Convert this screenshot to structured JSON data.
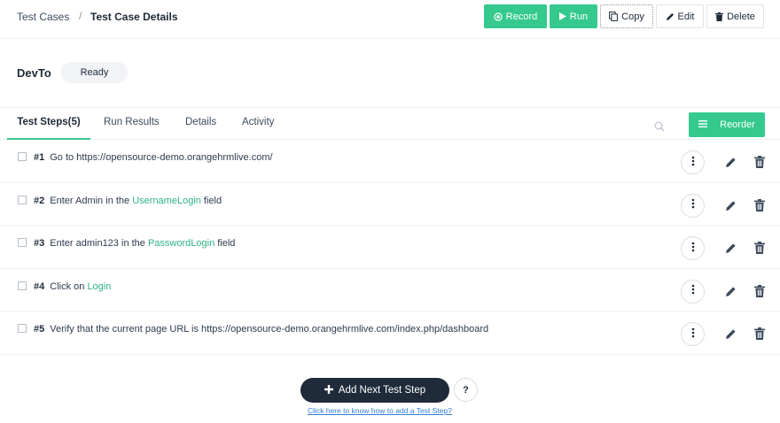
{
  "breadcrumb": {
    "parent": "Test Cases",
    "separator": "/",
    "current": "Test Case Details"
  },
  "toolbar": {
    "record_label": "Record",
    "run_label": "Run",
    "copy_label": "Copy",
    "edit_label": "Edit",
    "delete_label": "Delete"
  },
  "test_case": {
    "title": "DevTo",
    "status": "Ready"
  },
  "tabs": [
    {
      "label": "Test Steps(5)",
      "active": true
    },
    {
      "label": "Run Results",
      "active": false
    },
    {
      "label": "Details",
      "active": false
    },
    {
      "label": "Activity",
      "active": false
    }
  ],
  "reorder_label": "Reorder",
  "steps": [
    {
      "num": "#1",
      "parts": [
        {
          "text": "Go to ",
          "hl": false
        },
        {
          "text": "https://opensource-demo.orangehrmlive.com/",
          "hl": false
        }
      ]
    },
    {
      "num": "#2",
      "parts": [
        {
          "text": "Enter ",
          "hl": false
        },
        {
          "text": "Admin",
          "hl": false
        },
        {
          "text": " in the ",
          "hl": false
        },
        {
          "text": "UsernameLogin",
          "hl": true
        },
        {
          "text": " field",
          "hl": false
        }
      ]
    },
    {
      "num": "#3",
      "parts": [
        {
          "text": "Enter ",
          "hl": false
        },
        {
          "text": "admin123",
          "hl": false
        },
        {
          "text": " in the ",
          "hl": false
        },
        {
          "text": "PasswordLogin",
          "hl": true
        },
        {
          "text": " field",
          "hl": false
        }
      ]
    },
    {
      "num": "#4",
      "parts": [
        {
          "text": "Click on ",
          "hl": false
        },
        {
          "text": "Login",
          "hl": true
        }
      ]
    },
    {
      "num": "#5",
      "parts": [
        {
          "text": "Verify that the current page URL is ",
          "hl": false
        },
        {
          "text": "https://opensource-demo.orangehrmlive.com/index.php/dashboard",
          "hl": false
        }
      ]
    }
  ],
  "add_step_label": "Add Next Test Step",
  "help_button_label": "?",
  "help_link": "Click here to know how to add a Test Step?",
  "colors": {
    "accent_green": "#35c98e",
    "dark_button": "#1f2a3a",
    "link_blue": "#2f7fd6"
  },
  "icons": {
    "record": "record-icon",
    "run": "play-icon",
    "copy": "copy-icon",
    "edit": "pencil-icon",
    "delete": "trash-icon",
    "search": "search-icon",
    "reorder": "hamburger-icon",
    "step_menu": "kebab-icon",
    "add": "plus-icon"
  }
}
